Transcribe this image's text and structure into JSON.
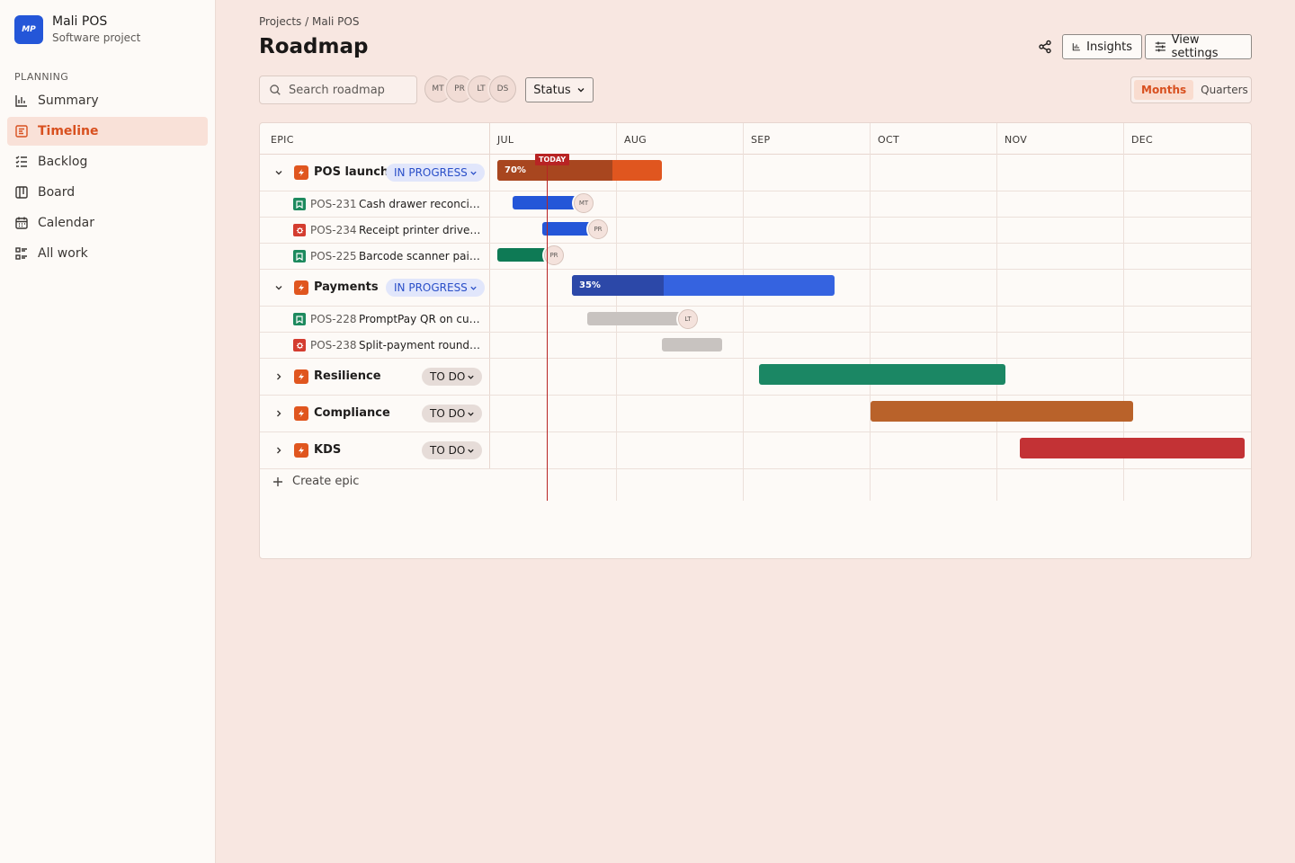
{
  "project": {
    "logo": "MP",
    "name": "Mali POS",
    "type": "Software project"
  },
  "sidebar": {
    "section": "PLANNING",
    "items": [
      {
        "label": "Summary",
        "icon": "chart-icon"
      },
      {
        "label": "Timeline",
        "icon": "timeline-icon",
        "active": true
      },
      {
        "label": "Backlog",
        "icon": "backlog-icon"
      },
      {
        "label": "Board",
        "icon": "board-icon"
      },
      {
        "label": "Calendar",
        "icon": "calendar-icon"
      },
      {
        "label": "All work",
        "icon": "list-icon"
      }
    ]
  },
  "header": {
    "breadcrumb": "Projects / Mali POS",
    "title": "Roadmap",
    "insights_label": "Insights",
    "view_settings_label": "View settings"
  },
  "toolbar": {
    "search_placeholder": "Search roadmap",
    "avatars": [
      "MT",
      "PR",
      "LT",
      "DS"
    ],
    "status_label": "Status",
    "view_modes": [
      "Months",
      "Quarters"
    ],
    "selected_view": "Months"
  },
  "timeline": {
    "epic_header": "EPIC",
    "months": [
      "JUL",
      "AUG",
      "SEP",
      "OCT",
      "NOV",
      "DEC"
    ],
    "today_label": "TODAY",
    "create_label": "Create epic",
    "epics": [
      {
        "name": "POS launch",
        "status": "IN PROGRESS",
        "status_type": "progress",
        "expanded": true,
        "progress_label": "70%",
        "progress": 0.7,
        "color": "#e0561f",
        "fill_color": "#a8461f",
        "issues": [
          {
            "key": "POS-231",
            "summary": "Cash drawer reconciliation",
            "type": "story",
            "assignee": "MT",
            "color": "#2456d8"
          },
          {
            "key": "POS-234",
            "summary": "Receipt printer driver fix",
            "type": "bug",
            "assignee": "PR",
            "color": "#2456d8"
          },
          {
            "key": "POS-225",
            "summary": "Barcode scanner pairing",
            "type": "story",
            "assignee": "PR",
            "color": "#0e7a55"
          }
        ]
      },
      {
        "name": "Payments",
        "status": "IN PROGRESS",
        "status_type": "progress",
        "expanded": true,
        "progress_label": "35%",
        "progress": 0.35,
        "color": "#3563e0",
        "fill_color": "#2c48a8",
        "issues": [
          {
            "key": "POS-228",
            "summary": "PromptPay QR on customer display",
            "type": "story",
            "assignee": "LT",
            "color": "#c8c3c0"
          },
          {
            "key": "POS-238",
            "summary": "Split-payment rounding",
            "type": "bug",
            "assignee": "",
            "color": "#c8c3c0"
          }
        ]
      },
      {
        "name": "Resilience",
        "status": "TO DO",
        "status_type": "todo",
        "expanded": false,
        "color": "#1b8764"
      },
      {
        "name": "Compliance",
        "status": "TO DO",
        "status_type": "todo",
        "expanded": false,
        "color": "#b9622a"
      },
      {
        "name": "KDS",
        "status": "TO DO",
        "status_type": "todo",
        "expanded": false,
        "color": "#c33235"
      }
    ]
  },
  "colors": {
    "accent": "#d8501f",
    "brand": "#2456d8",
    "today": "#b82424",
    "background": "#f8e7e1"
  }
}
